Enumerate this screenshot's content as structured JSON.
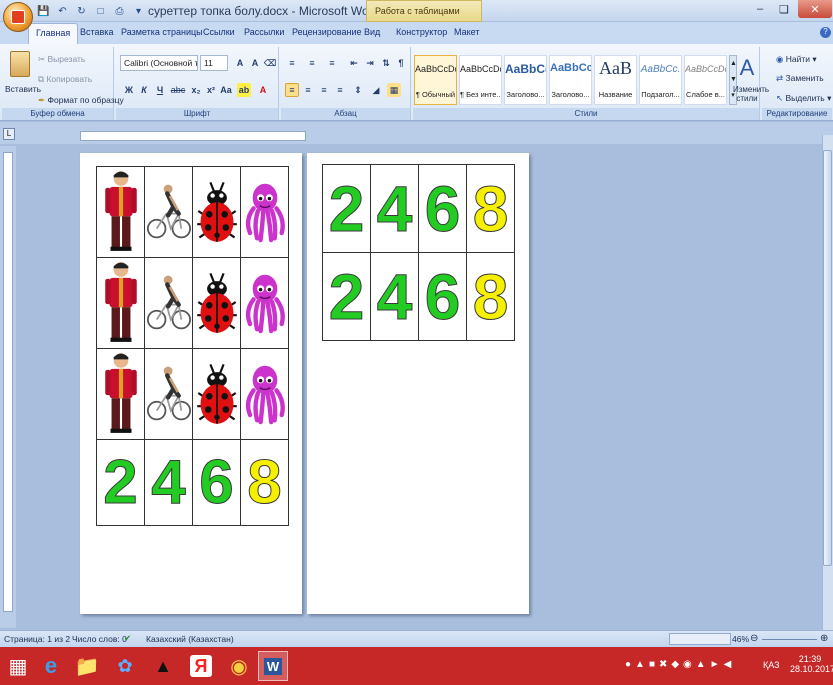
{
  "window": {
    "title": "суреттер топка болу.docx - Microsoft Word",
    "context_tab_title": "Работа с таблицами"
  },
  "tabs": [
    {
      "label": "Главная",
      "active": true
    },
    {
      "label": "Вставка"
    },
    {
      "label": "Разметка страницы"
    },
    {
      "label": "Ссылки"
    },
    {
      "label": "Рассылки"
    },
    {
      "label": "Рецензирование"
    },
    {
      "label": "Вид"
    },
    {
      "label": "Конструктор"
    },
    {
      "label": "Макет"
    }
  ],
  "ribbon": {
    "clipboard": {
      "label": "Буфер обмена",
      "paste": "Вставить",
      "cut": "Вырезать",
      "copy": "Копировать",
      "format_painter": "Формат по образцу"
    },
    "font": {
      "label": "Шрифт",
      "font_name": "Calibri (Основной те",
      "font_size": "11"
    },
    "paragraph": {
      "label": "Абзац"
    },
    "styles": {
      "label": "Стили",
      "change_styles": "Изменить стили",
      "items": [
        {
          "sample": "AaBbCcDc",
          "name": "¶ Обычный",
          "selected": true
        },
        {
          "sample": "AaBbCcDc",
          "name": "¶ Без инте..."
        },
        {
          "sample": "AaBbC(",
          "name": "Заголово..."
        },
        {
          "sample": "AaBbCc",
          "name": "Заголово..."
        },
        {
          "sample": "AaB",
          "name": "Название"
        },
        {
          "sample": "AaBbCc.",
          "name": "Подзагол..."
        },
        {
          "sample": "AaBbCcDc",
          "name": "Слабое в..."
        }
      ]
    },
    "editing": {
      "label": "Редактирование",
      "find": "Найти",
      "replace": "Заменить",
      "select": "Выделить"
    }
  },
  "document": {
    "page1_rows": [
      [
        "person",
        "cyclist",
        "ladybug",
        "octopus"
      ],
      [
        "person",
        "cyclist",
        "ladybug",
        "octopus"
      ],
      [
        "person",
        "cyclist",
        "ladybug",
        "octopus"
      ]
    ],
    "numbers": [
      {
        "value": "2",
        "color": "#22cc22"
      },
      {
        "value": "4",
        "color": "#22cc22"
      },
      {
        "value": "6",
        "color": "#22cc22"
      },
      {
        "value": "8",
        "color": "#f5f000"
      }
    ]
  },
  "status": {
    "page": "Страница: 1 из 2",
    "words": "Число слов: 0",
    "language": "Казахский (Казахстан)",
    "zoom": "46%"
  },
  "taskbar": {
    "lang": "ҚАЗ",
    "time": "21:39",
    "date": "28.10.2017"
  }
}
